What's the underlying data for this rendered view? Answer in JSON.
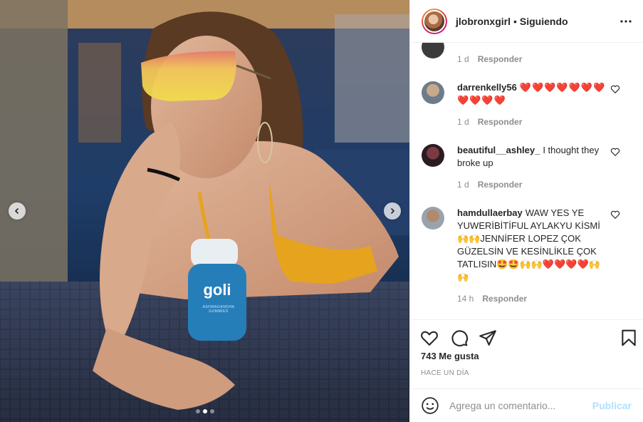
{
  "post": {
    "owner_username": "jlobronxgirl",
    "separator": "•",
    "follow_status": "Siguiendo",
    "more_icon": "more-horizontal-icon"
  },
  "media": {
    "bottle_brand": "goli",
    "bottle_subtext": "ASHWAGANDHA GUMMIES",
    "carousel": {
      "total_slides": 3,
      "active_slide": 2
    }
  },
  "comments": [
    {
      "username": "",
      "text": "",
      "time": "1 d",
      "reply_label": "Responder"
    },
    {
      "username": "darrenkelly56",
      "text": "❤️❤️❤️❤️❤️❤️❤️❤️❤️❤️❤️",
      "time": "1 d",
      "reply_label": "Responder"
    },
    {
      "username": "beautiful__ashley_",
      "text": "I thought they broke up",
      "time": "1 d",
      "reply_label": "Responder"
    },
    {
      "username": "hamdullaerbay",
      "text": "WAW YES YE YUWERİBİTİFUL AYLAKYU KİSMİ 🙌🙌JENNİFER LOPEZ ÇOK GÜZELSİN VE KESİNLİKLE ÇOK TATLISIN🤩🤩🙌🙌❤️❤️❤️❤️🙌🙌",
      "time": "14 h",
      "reply_label": "Responder"
    }
  ],
  "actions": {
    "like_icon": "heart-icon",
    "comment_icon": "comment-bubble-icon",
    "share_icon": "paper-plane-icon",
    "save_icon": "bookmark-icon"
  },
  "likes_text": "743 Me gusta",
  "date_text": "HACE UN DÍA",
  "composer": {
    "emoji_icon": "smiley-icon",
    "placeholder": "Agrega un comentario...",
    "publish_label": "Publicar"
  },
  "colors": {
    "text_primary": "#262626",
    "text_secondary": "#8e8e8e",
    "publish_disabled": "#b2dffc",
    "border": "#efefef"
  }
}
